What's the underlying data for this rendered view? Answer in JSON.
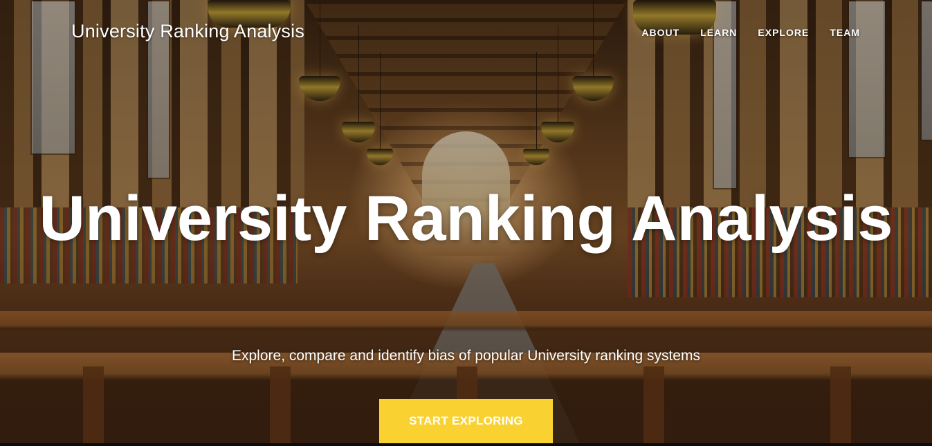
{
  "nav": {
    "brand": "University Ranking Analysis",
    "links": [
      "ABOUT",
      "LEARN",
      "EXPLORE",
      "TEAM"
    ]
  },
  "hero": {
    "title": "University Ranking Analysis",
    "subtitle": "Explore, compare and identify bias of popular University ranking systems",
    "cta_label": "START EXPLORING"
  },
  "colors": {
    "cta_background": "#f9d231",
    "text": "#ffffff"
  }
}
